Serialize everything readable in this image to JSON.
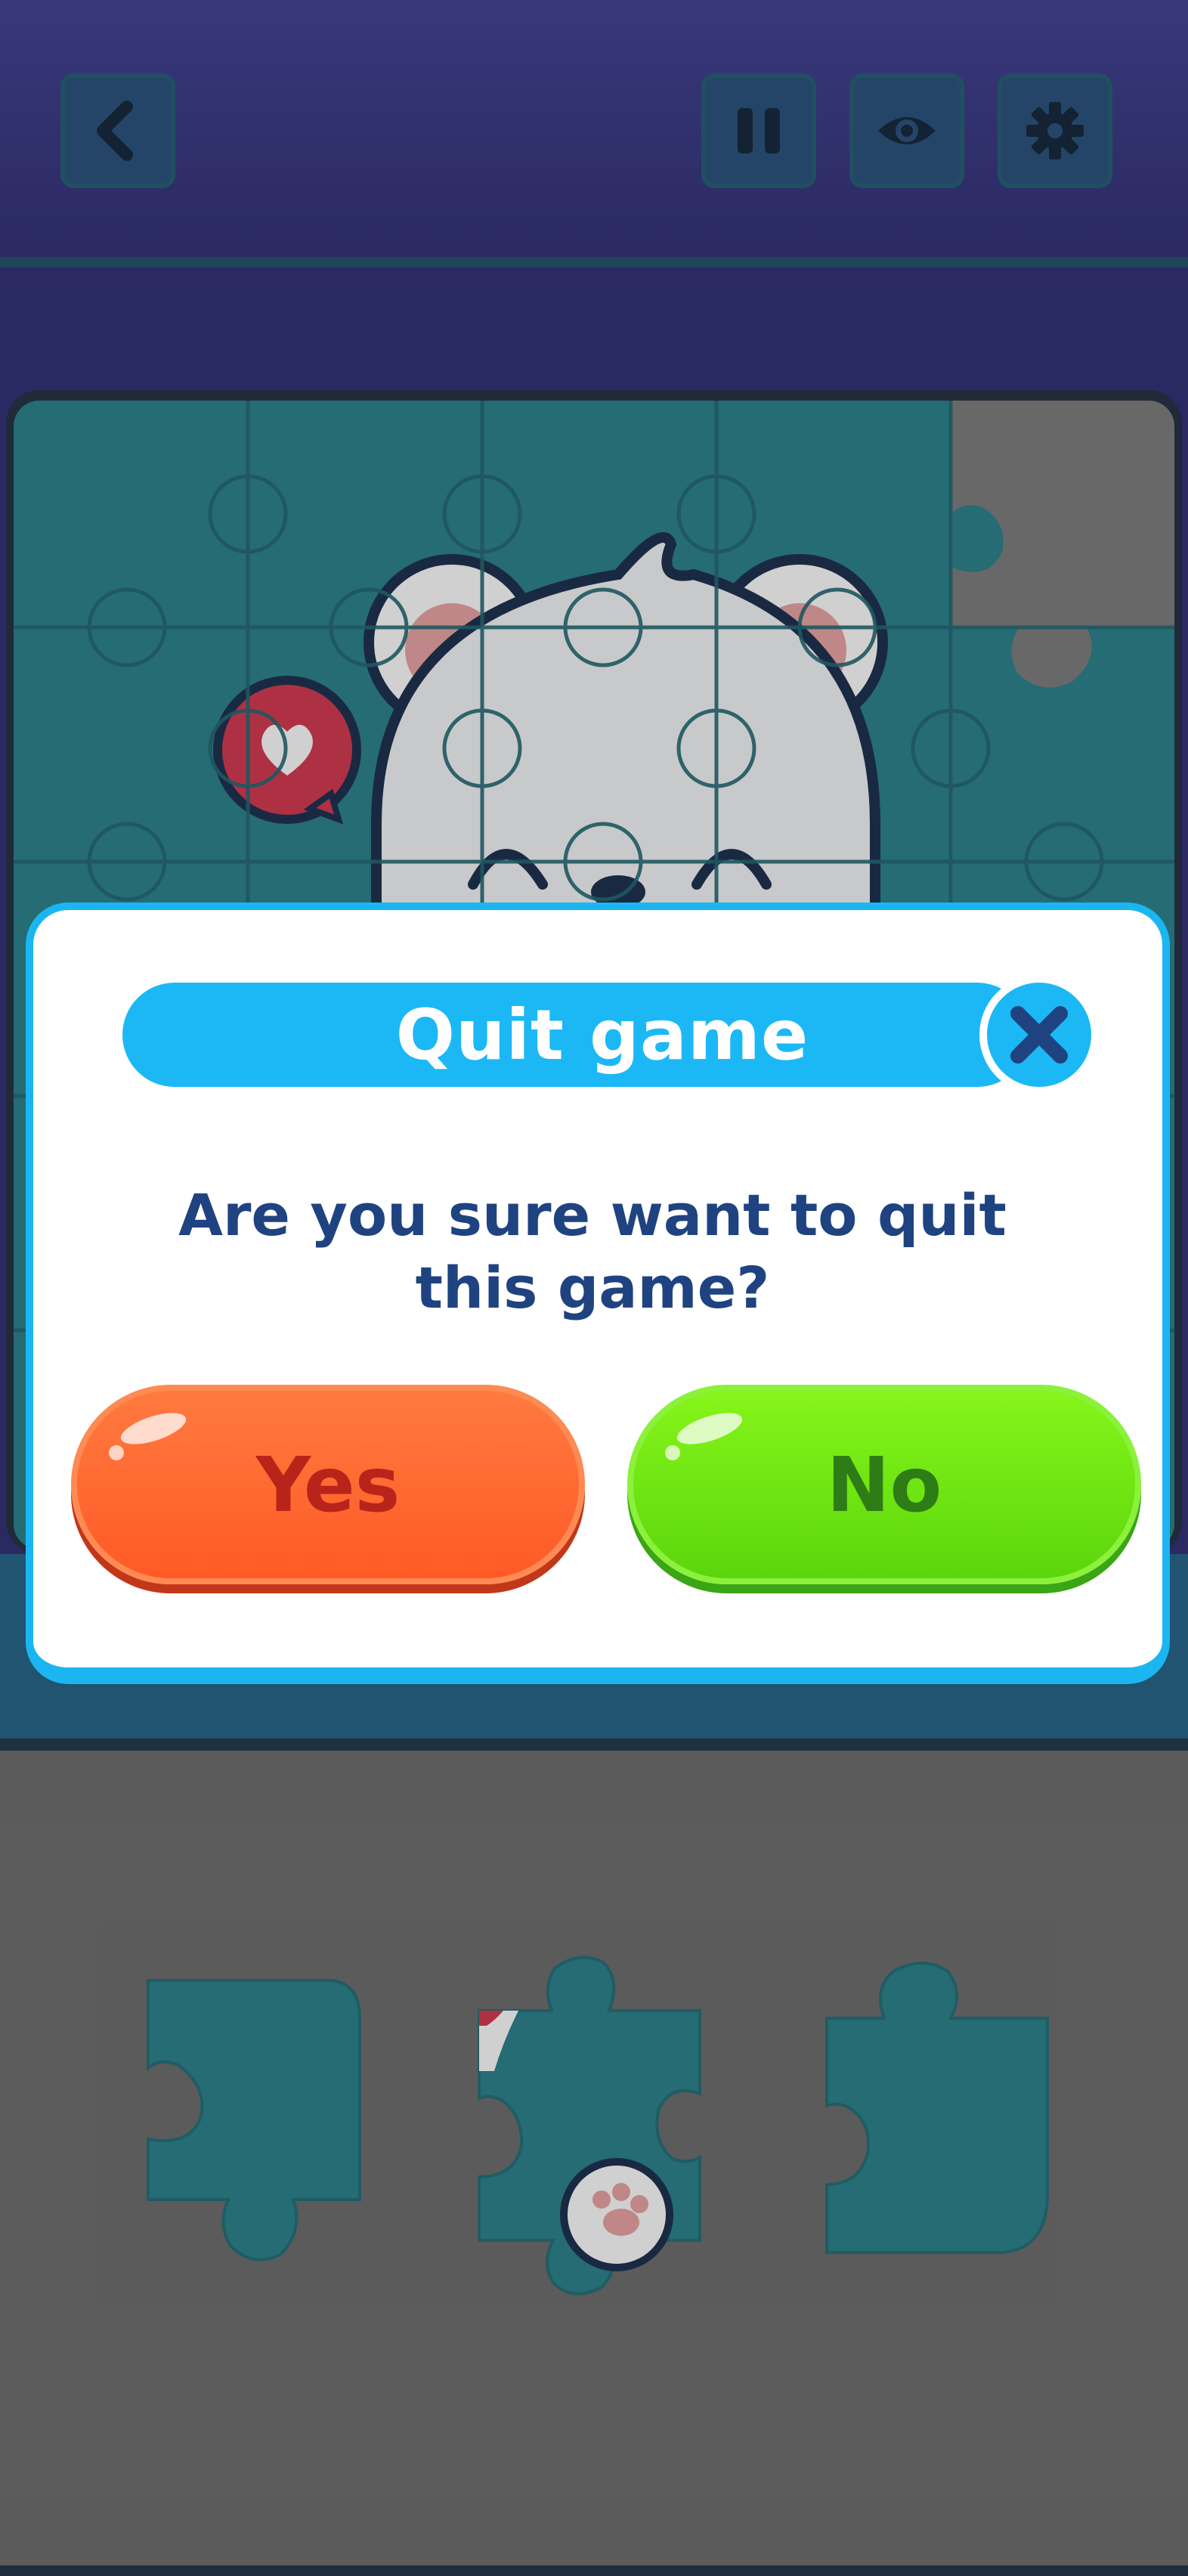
{
  "toolbar": {
    "back_icon": "chevron-left-icon",
    "pause_icon": "pause-icon",
    "preview_icon": "eye-icon",
    "settings_icon": "gear-icon"
  },
  "puzzle": {
    "grid_rows": 5,
    "grid_cols": 5,
    "image": "polar bear with heart speech bubble"
  },
  "tray": {
    "pieces_visible": 3
  },
  "dialog": {
    "title": "Quit game",
    "close_icon": "close-icon",
    "message": "Are you sure want to quit this game?",
    "yes_label": "Yes",
    "no_label": "No"
  },
  "colors": {
    "accent": "#1cb8f6",
    "yes": "#ff5a26",
    "no": "#5bd60c",
    "text": "#1f4380"
  }
}
